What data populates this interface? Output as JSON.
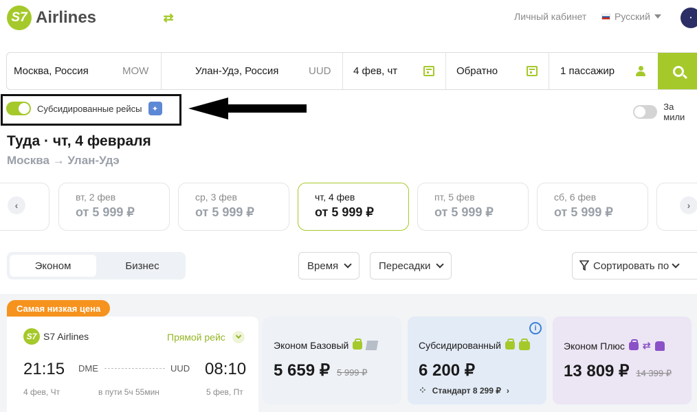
{
  "header": {
    "logo_mark": "S7",
    "logo_text": "Airlines",
    "cabinet": "Личный кабинет",
    "language": "Русский"
  },
  "search": {
    "from_city": "Москва, Россия",
    "from_code": "MOW",
    "to_city": "Улан-Удэ, Россия",
    "to_code": "UUD",
    "depart_date": "4 фев, чт",
    "return_date": "Обратно",
    "passengers": "1 пассажир"
  },
  "toggles": {
    "subsidized_label": "Субсидированные рейсы",
    "subsidized_on": true,
    "miles_label": "За мили",
    "miles_on": false
  },
  "heading": {
    "title": "Туда · чт, 4 февраля",
    "route": "Москва → Улан-Удэ"
  },
  "dates": [
    {
      "label": "вт, 2 фев",
      "price": "от 5 999 ₽"
    },
    {
      "label": "ср, 3 фев",
      "price": "от 5 999 ₽"
    },
    {
      "label": "чт, 4 фев",
      "price": "от 5 999 ₽",
      "selected": true
    },
    {
      "label": "пт, 5 фев",
      "price": "от 5 999 ₽"
    },
    {
      "label": "сб, 6 фев",
      "price": "от 5 999 ₽"
    }
  ],
  "cabin_tabs": [
    "Эконом",
    "Бизнес"
  ],
  "filters": {
    "time": "Время",
    "transfers": "Пересадки",
    "sort": "Сортировать по"
  },
  "result": {
    "badge": "Самая низкая цена",
    "airline": "S7 Airlines",
    "direct": "Прямой рейс",
    "dep_time": "21:15",
    "dep_airport": "DME",
    "dep_date": "4 фев, Чт",
    "arr_time": "08:10",
    "arr_airport": "UUD",
    "arr_date": "5 фев, Пт",
    "duration": "в пути 5ч 55мин"
  },
  "fares": [
    {
      "name": "Эконом Базовый",
      "price": "5 659 ₽",
      "old_price": "5 999 ₽",
      "bg": "#eef1f6"
    },
    {
      "name": "Субсидированный",
      "price": "6 200 ₽",
      "extra": "Стандарт 8 299 ₽",
      "bg": "#e3ebf6"
    },
    {
      "name": "Эконом Плюс",
      "price": "13 809 ₽",
      "old_price": "14 399 ₽",
      "bg": "#ece5f4"
    }
  ],
  "colors": {
    "accent": "#a5c92a",
    "badge": "#f6921e",
    "plus": "#8b52c7"
  }
}
